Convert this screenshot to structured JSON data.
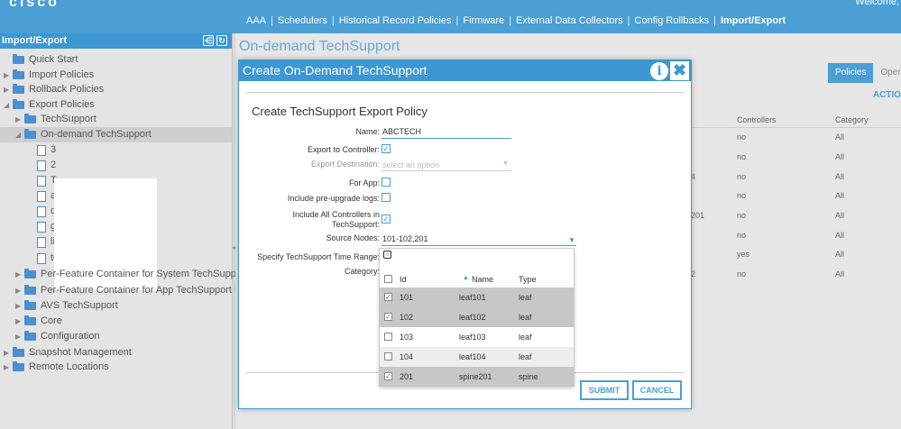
{
  "header": {
    "logo": "cisco",
    "welcome": "Welcome,",
    "subnav": [
      "AAA",
      "Schedulers",
      "Historical Record Policies",
      "Firmware",
      "External Data Collectors",
      "Config Rollbacks",
      "Import/Export"
    ],
    "separator": "|"
  },
  "sidebar": {
    "title": "Import/Export",
    "items": [
      {
        "label": "Quick Start"
      },
      {
        "label": "Import Policies"
      },
      {
        "label": "Rollback Policies"
      },
      {
        "label": "Export Policies"
      },
      {
        "label": "TechSupport"
      },
      {
        "label": "On-demand TechSupport"
      },
      {
        "label": "3"
      },
      {
        "label": "2"
      },
      {
        "label": "T"
      },
      {
        "label": "a"
      },
      {
        "label": "d"
      },
      {
        "label": "g"
      },
      {
        "label": "li"
      },
      {
        "label": "test"
      },
      {
        "label": "Per-Feature Container for System TechSupport Data"
      },
      {
        "label": "Per-Feature Container for App TechSupport Data"
      },
      {
        "label": "AVS TechSupport"
      },
      {
        "label": "Core"
      },
      {
        "label": "Configuration"
      },
      {
        "label": "Snapshot Management"
      },
      {
        "label": "Remote Locations"
      }
    ]
  },
  "main": {
    "title": "On-demand TechSupport",
    "tabs": [
      "Policies",
      "Oper"
    ],
    "actions": "ACTIO",
    "columns": [
      "Controllers",
      "Category"
    ],
    "bg_rows": [
      {
        "left": "",
        "controllers": "no",
        "category": "All"
      },
      {
        "left": "",
        "controllers": "no",
        "category": "All"
      },
      {
        "left": "4",
        "controllers": "no",
        "category": "All"
      },
      {
        "left": "",
        "controllers": "no",
        "category": "All"
      },
      {
        "left": "201",
        "controllers": "no",
        "category": "All"
      },
      {
        "left": "",
        "controllers": "no",
        "category": "All"
      },
      {
        "left": "",
        "controllers": "yes",
        "category": "All"
      },
      {
        "left": "2",
        "controllers": "no",
        "category": "All"
      }
    ]
  },
  "modal": {
    "title": "Create On-Demand TechSupport",
    "section": "Create TechSupport Export Policy",
    "labels": {
      "name": "Name:",
      "export_to_controller": "Export to Controller:",
      "export_destination": "Export Destination:",
      "for_app": "For App:",
      "pre_upgrade": "Include pre-upgrade logs:",
      "all_controllers_1": "Include All Controllers in",
      "all_controllers_2": "TechSupport:",
      "source_nodes": "Source Nodes:",
      "time_range": "Specify TechSupport Time Range:",
      "category": "Category:"
    },
    "values": {
      "name": "ABCTECH",
      "export_destination_placeholder": "select an option",
      "source_nodes": "101-102,201"
    },
    "checkboxes": {
      "export_to_controller": true,
      "for_app": false,
      "pre_upgrade": false,
      "all_controllers": true
    },
    "dropdown": {
      "headers": {
        "id": "Id",
        "name": "Name",
        "type": "Type"
      },
      "rows": [
        {
          "id": "101",
          "name": "leaf101",
          "type": "leaf",
          "checked": true
        },
        {
          "id": "102",
          "name": "leaf102",
          "type": "leaf",
          "checked": true
        },
        {
          "id": "103",
          "name": "leaf103",
          "type": "leaf",
          "checked": false
        },
        {
          "id": "104",
          "name": "leaf104",
          "type": "leaf",
          "checked": false
        },
        {
          "id": "201",
          "name": "spine201",
          "type": "spine",
          "checked": true
        }
      ]
    },
    "buttons": {
      "submit": "SUBMIT",
      "cancel": "CANCEL"
    }
  },
  "colors": {
    "header_blue": "#4a9fd5",
    "panel_blue": "#3d97d3",
    "selected_grey": "#c7c7c7"
  },
  "icons": [
    "folder-icon",
    "document-icon",
    "info-icon",
    "close-icon",
    "search-icon",
    "checkbox-icon"
  ]
}
